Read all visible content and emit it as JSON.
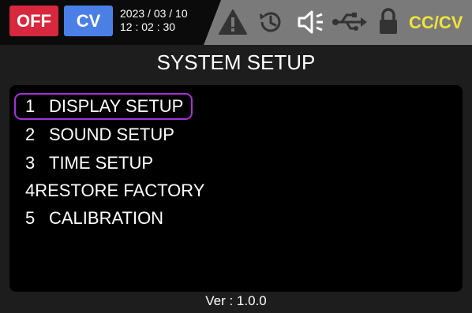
{
  "status": {
    "output_state": "OFF",
    "mode": "CV",
    "date": "2023 / 03 / 10",
    "time": "12 : 02 : 30",
    "icons": [
      "warning-icon",
      "history-icon",
      "speaker-icon",
      "usb-icon",
      "lock-icon"
    ],
    "regulation_mode": "CC/CV"
  },
  "page": {
    "title": "SYSTEM SETUP"
  },
  "menu": {
    "items": [
      {
        "num": "1",
        "label": "DISPLAY SETUP",
        "selected": true
      },
      {
        "num": "2",
        "label": "SOUND SETUP",
        "selected": false
      },
      {
        "num": "3",
        "label": "TIME SETUP",
        "selected": false
      },
      {
        "num": "4",
        "label": "RESTORE FACTORY",
        "selected": false
      },
      {
        "num": "5",
        "label": "CALIBRATION",
        "selected": false
      }
    ]
  },
  "footer": {
    "version": "Ver :  1.0.0"
  },
  "colors": {
    "off_button": "#d8283d",
    "cv_button": "#4a7fe6",
    "cc_cv_text": "#f0e43a",
    "selection_border": "#a630d8"
  }
}
